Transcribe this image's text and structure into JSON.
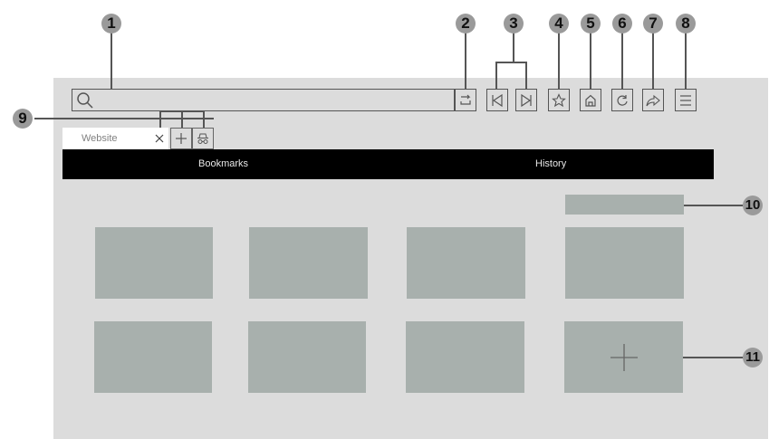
{
  "tabs": [
    {
      "title": "Website",
      "close_icon": "close-icon"
    }
  ],
  "toolbar_icons": [
    "search-icon",
    "go-icon",
    "back-icon",
    "forward-icon",
    "star-icon",
    "home-icon",
    "refresh-icon",
    "share-icon",
    "menu-icon",
    "new-tab-icon",
    "private-tab-icon"
  ],
  "menu": {
    "bookmarks_label": "Bookmarks",
    "history_label": "History"
  },
  "add_tile_icon": "plus-icon",
  "callouts": [
    "1",
    "2",
    "3",
    "4",
    "5",
    "6",
    "7",
    "8",
    "9",
    "10",
    "11"
  ],
  "colors": {
    "browser_bg": "#dcdcdc",
    "menubar_bg": "#000000",
    "tile_bg": "#a8b0ad",
    "callout_bg": "#9a9a9a"
  }
}
